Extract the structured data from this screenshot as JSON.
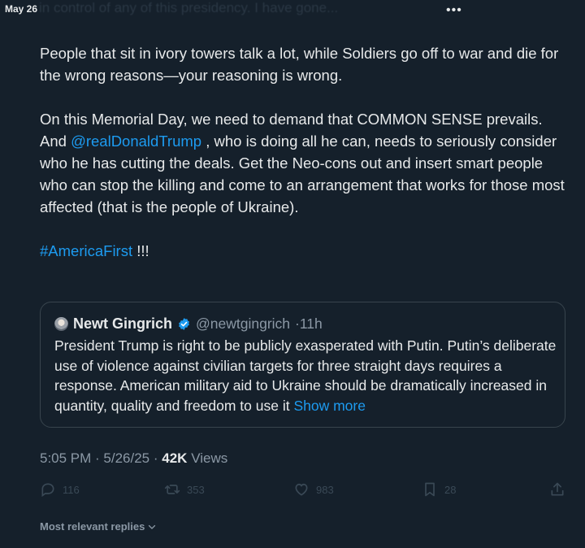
{
  "status_bar": {
    "time": "May 26"
  },
  "header": {
    "ghost_text": "in control of any of this presidency. I have gone..."
  },
  "tweet": {
    "paragraph1": "People that sit in ivory towers talk a lot, while Soldiers go off to war and die for the wrong reasons—your reasoning is wrong.",
    "p2_part1": "On this Memorial Day, we need to demand that COMMON SENSE prevails. And ",
    "p2_mention": "@realDonaldTrump",
    "p2_part2": " , who is doing all he can, needs to seriously consider who he has cutting the deals. Get the Neo-cons out and insert smart people who can stop the killing and come to an arrangement that works for those most affected (that is the people of Ukraine).",
    "hashtag": "#AmericaFirst",
    "hashtag_suffix": " !!!"
  },
  "quote": {
    "name": "Newt Gingrich",
    "handle": "@newtgingrich",
    "time": "·11h",
    "text": "President Trump is right to be publicly exasperated with Putin. Putin’s deliberate use of violence against civilian targets for three straight days requires a response. American military aid to Ukraine should be dramatically increased in quantity, quality and freedom to use it",
    "show_more": "Show more"
  },
  "meta": {
    "time": "5:05 PM",
    "date": "5/26/25",
    "separator": " · ",
    "views_count": "42K",
    "views_label": "Views"
  },
  "actions": {
    "replies": "116",
    "reposts": "353",
    "likes": "983",
    "bookmarks": "28"
  },
  "replies_sort": {
    "label": "Most relevant replies"
  },
  "colors": {
    "background": "#15202b",
    "text": "#e7e9ea",
    "link": "#1d9bf0",
    "muted": "#8b98a5",
    "border": "#38444d"
  },
  "icons": [
    "more-icon",
    "verified-icon",
    "reply-icon",
    "repost-icon",
    "like-icon",
    "bookmark-icon",
    "share-icon",
    "chevron-down-icon"
  ]
}
